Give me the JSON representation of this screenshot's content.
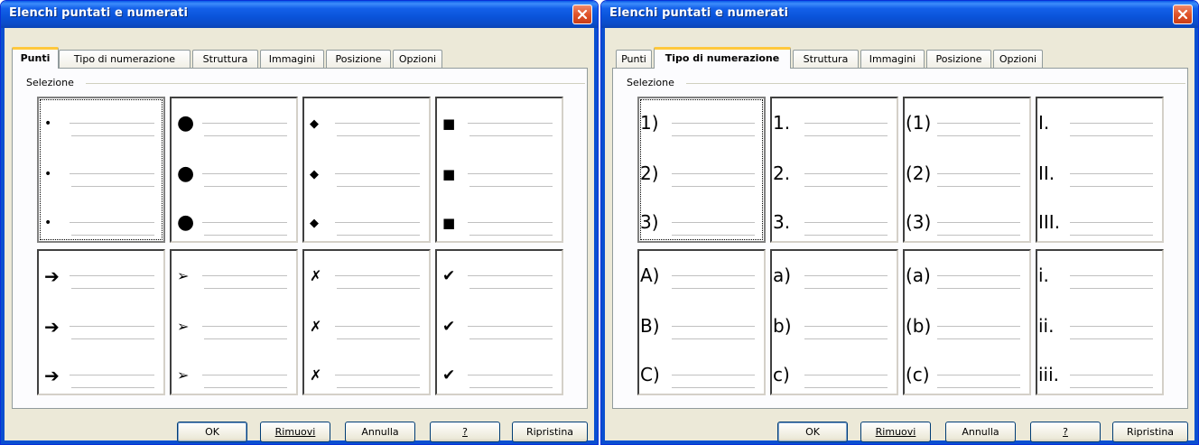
{
  "dialogs": [
    {
      "title": "Elenchi puntati e numerati",
      "tabs": [
        "Punti",
        "Tipo di numerazione",
        "Struttura",
        "Immagini",
        "Posizione",
        "Opzioni"
      ],
      "active_tab": 0,
      "group_label": "Selezione",
      "cells": [
        {
          "glyph": "•",
          "size": 14
        },
        {
          "glyph": "●",
          "size": 22
        },
        {
          "glyph": "◆",
          "size": 13
        },
        {
          "glyph": "■",
          "size": 15
        },
        {
          "glyph": "➔",
          "size": 20
        },
        {
          "glyph": "➢",
          "size": 16
        },
        {
          "glyph": "✗",
          "size": 16
        },
        {
          "glyph": "✔",
          "size": 17
        }
      ],
      "buttons": [
        "OK",
        "Rimuovi",
        "Annulla",
        "?",
        "Ripristina"
      ]
    },
    {
      "title": "Elenchi puntati e numerati",
      "tabs": [
        "Punti",
        "Tipo di numerazione",
        "Struttura",
        "Immagini",
        "Posizione",
        "Opzioni"
      ],
      "active_tab": 1,
      "group_label": "Selezione",
      "cells": [
        {
          "items": [
            "1)",
            "2)",
            "3)"
          ]
        },
        {
          "items": [
            "1.",
            "2.",
            "3."
          ]
        },
        {
          "items": [
            "(1)",
            "(2)",
            "(3)"
          ]
        },
        {
          "items": [
            "I.",
            "II.",
            "III."
          ]
        },
        {
          "items": [
            "A)",
            "B)",
            "C)"
          ]
        },
        {
          "items": [
            "a)",
            "b)",
            "c)"
          ]
        },
        {
          "items": [
            "(a)",
            "(b)",
            "(c)"
          ]
        },
        {
          "items": [
            "i.",
            "ii.",
            "iii."
          ]
        }
      ],
      "buttons": [
        "OK",
        "Rimuovi",
        "Annulla",
        "?",
        "Ripristina"
      ]
    }
  ],
  "colors": {
    "titlebar": "#0a53d9",
    "dialog_bg": "#ece9d8",
    "active_tab_accent": "#ffc83c",
    "close_button": "#e0542a"
  },
  "icons": [
    "close-icon"
  ]
}
